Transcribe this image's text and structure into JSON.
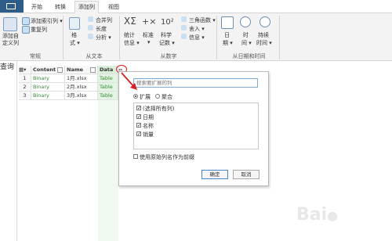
{
  "tabs": [
    "开始",
    "转换",
    "添加列",
    "视图"
  ],
  "ribbon": {
    "group_general": {
      "custom_col_l1": "添加自",
      "custom_col_l2": "定义列",
      "index_col": "添加索引列 ▾",
      "dup_col": "重复列",
      "label": "常规"
    },
    "group_text": {
      "format": "格",
      "format2": "式 ▾",
      "merge": "合并列",
      "length": "长度",
      "analyze": "分析 ▾",
      "label": "从文本"
    },
    "group_number": {
      "stats_l1": "统计",
      "stats_l2": "信息 ▾",
      "std_l1": "标准",
      "std_l2": "▾",
      "sci_l1": "科学",
      "sci_l2": "记数 ▾",
      "trig": "三角函数 ▾",
      "round": "舍入 ▾",
      "info": "信息 ▾",
      "label": "从数字",
      "ten": "10²"
    },
    "group_date": {
      "date_l1": "日",
      "date_l2": "期 ▾",
      "time_l1": "时",
      "time_l2": "间 ▾",
      "dur_l1": "持续",
      "dur_l2": "时间 ▾",
      "label": "从日期和时间"
    }
  },
  "left": {
    "query_label": "查询"
  },
  "grid": {
    "headers": [
      "Content",
      "Name",
      "Data"
    ],
    "rows": [
      {
        "n": "1",
        "content": "Binary",
        "name": "1月.xlsx",
        "data": "Table"
      },
      {
        "n": "2",
        "content": "Binary",
        "name": "2月.xlsx",
        "data": "Table"
      },
      {
        "n": "3",
        "content": "Binary",
        "name": "3月.xlsx",
        "data": "Table"
      }
    ]
  },
  "popup": {
    "search_placeholder": "搜索要扩展的列",
    "radio_expand": "扩展",
    "radio_aggregate": "聚合",
    "items": [
      "(选择所有列)",
      "日期",
      "名称",
      "销量"
    ],
    "use_prefix": "使用原始列名作为前缀",
    "ok": "确定",
    "cancel": "取消"
  },
  "colors": {
    "accent": "#2f5d8a",
    "arrow": "#d42020",
    "green_col": "#e2f4e2"
  }
}
